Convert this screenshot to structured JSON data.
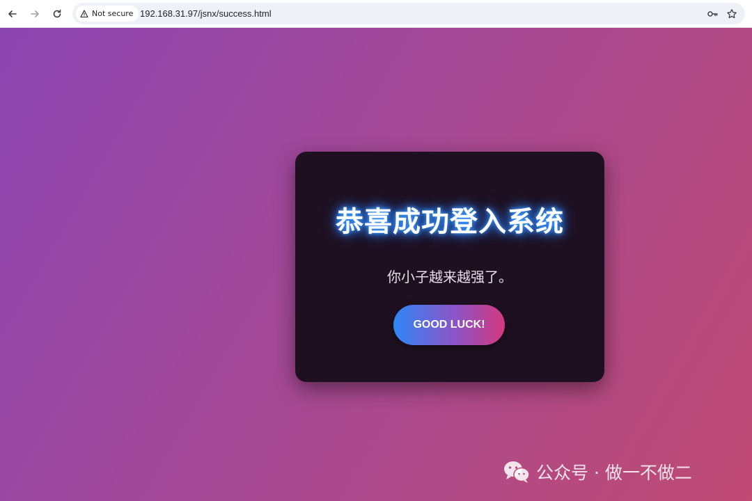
{
  "browser": {
    "security_label": "Not secure",
    "url": "192.168.31.97/jsnx/success.html",
    "icons": {
      "back": "arrow-left-icon",
      "forward": "arrow-right-icon",
      "reload": "reload-icon",
      "security": "warning-triangle-icon",
      "passwords": "key-icon",
      "bookmark": "star-icon"
    }
  },
  "page": {
    "background_colors": [
      "#8b45b1",
      "#bf4a72"
    ],
    "card": {
      "title": "恭喜成功登入系统",
      "subtitle": "你小子越来越强了。",
      "button_label": "GOOD LUCK!",
      "title_glow_color": "#2b7fff",
      "button_gradient": [
        "#2f86f5",
        "#d4387e"
      ]
    },
    "watermark": {
      "text": "公众号 · 做一不做二",
      "icon": "wechat-icon"
    }
  }
}
